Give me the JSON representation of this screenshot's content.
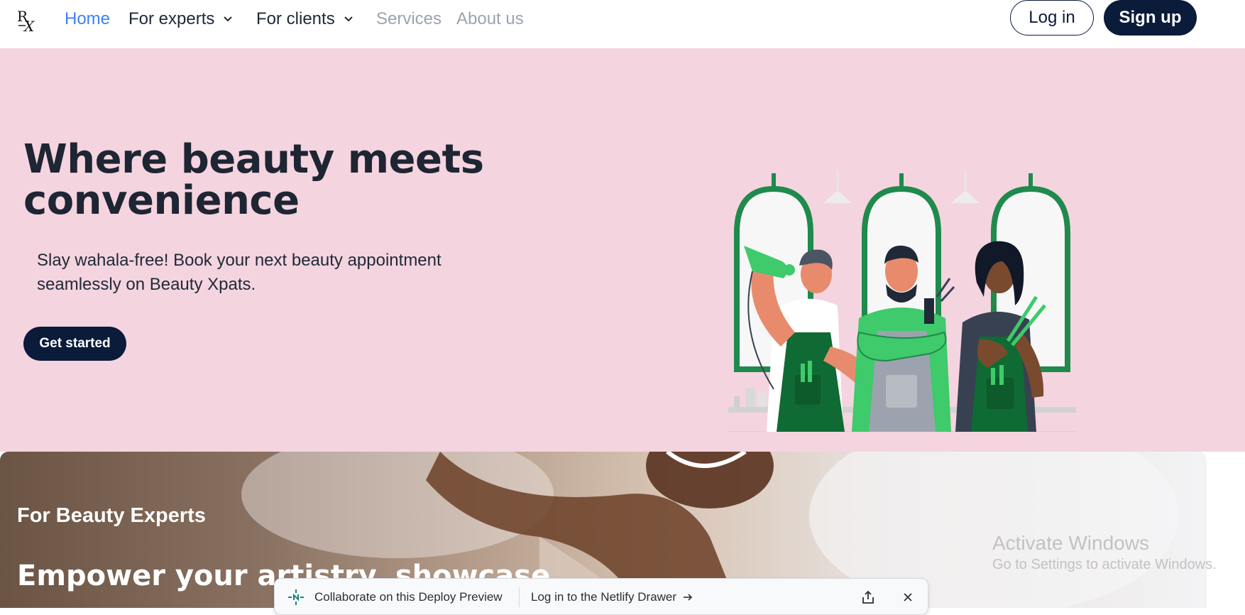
{
  "nav": {
    "logo": "R X",
    "links": [
      {
        "label": "Home"
      },
      {
        "label": "For experts"
      },
      {
        "label": "For clients"
      },
      {
        "label": "Services"
      },
      {
        "label": "About us"
      }
    ],
    "login_label": "Log in",
    "signup_label": "Sign up"
  },
  "hero": {
    "title_line1": "Where beauty meets",
    "title_line2": "convenience",
    "subtitle": "Slay wahala-free! Book your next beauty appointment seamlessly on Beauty Xpats.",
    "cta_label": "Get started"
  },
  "experts": {
    "eyebrow": "For Beauty Experts",
    "title": "Empower your artistry, showcase"
  },
  "watermark": {
    "title": "Activate Windows",
    "subtitle": "Go to Settings to activate Windows."
  },
  "netlify": {
    "collab_label": "Collaborate on this Deploy Preview",
    "login_label": "Log in to the Netlify Drawer",
    "icons": [
      "netlify-logo-icon",
      "arrow-right-icon",
      "share-icon",
      "close-icon"
    ]
  },
  "colors": {
    "hero_bg": "#f4d4df",
    "navy": "#0b1b3a",
    "active_link": "#3b82f6",
    "muted_link": "#9ca3af",
    "green": "#1f8a4c",
    "light_green": "#3fca6b"
  }
}
